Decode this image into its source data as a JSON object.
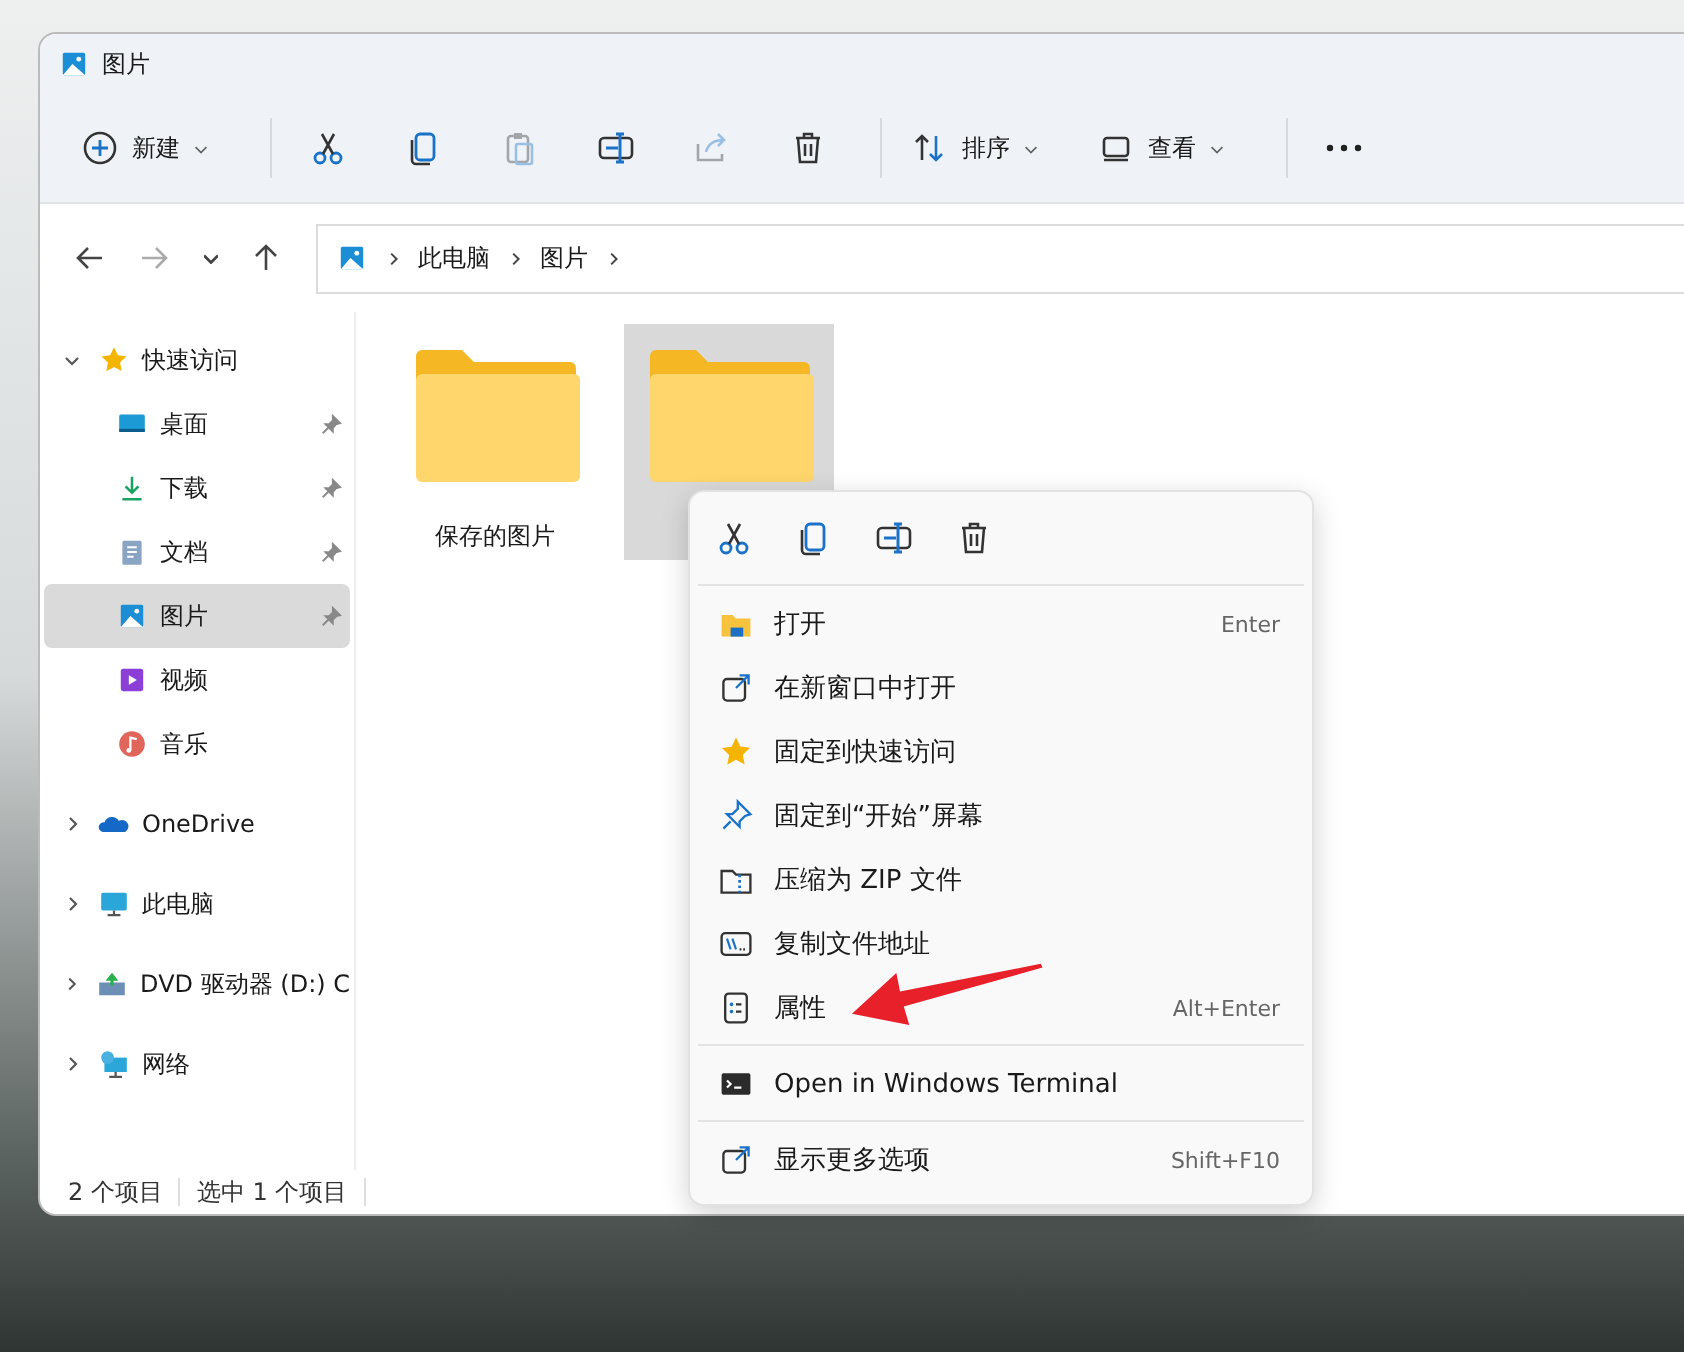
{
  "window": {
    "title": "图片"
  },
  "toolbar": {
    "items": [
      {
        "kind": "new",
        "label": "新建",
        "disabled": false
      },
      {
        "kind": "cut",
        "disabled": false
      },
      {
        "kind": "copy",
        "disabled": false
      },
      {
        "kind": "paste",
        "disabled": true
      },
      {
        "kind": "rename",
        "disabled": false
      },
      {
        "kind": "share",
        "disabled": true
      },
      {
        "kind": "delete",
        "disabled": false
      },
      {
        "kind": "sort",
        "label": "排序",
        "disabled": false
      },
      {
        "kind": "view",
        "label": "查看",
        "disabled": false
      },
      {
        "kind": "more",
        "disabled": false
      }
    ]
  },
  "navigation": {
    "back_disabled": false,
    "forward_disabled": true
  },
  "breadcrumb": [
    "此电脑",
    "图片"
  ],
  "sidebar": {
    "items": [
      {
        "kind": "star",
        "label": "快速访问",
        "expanded": true,
        "selected": false,
        "children": [
          {
            "kind": "desktop",
            "label": "桌面",
            "pinned": true,
            "selected": false
          },
          {
            "kind": "download",
            "label": "下载",
            "pinned": true,
            "selected": false
          },
          {
            "kind": "documents",
            "label": "文档",
            "pinned": true,
            "selected": false
          },
          {
            "kind": "pictures",
            "label": "图片",
            "pinned": true,
            "selected": true
          },
          {
            "kind": "videos",
            "label": "视频",
            "pinned": false,
            "selected": false
          },
          {
            "kind": "music",
            "label": "音乐",
            "pinned": false,
            "selected": false
          }
        ]
      },
      {
        "kind": "onedrive",
        "label": "OneDrive",
        "expanded": false,
        "selected": false
      },
      {
        "kind": "pc",
        "label": "此电脑",
        "expanded": false,
        "selected": false
      },
      {
        "kind": "dvd",
        "label": "DVD 驱动器 (D:) C",
        "expanded": false,
        "selected": false
      },
      {
        "kind": "network",
        "label": "网络",
        "expanded": false,
        "selected": false
      }
    ]
  },
  "files": [
    {
      "name": "保存的图片",
      "selected": false
    },
    {
      "selected": true
    }
  ],
  "status_bar": {
    "item_count": "2 个项目",
    "selection": "选中 1 个项目"
  },
  "context_menu": {
    "quick_actions": [
      {
        "kind": "cut"
      },
      {
        "kind": "copy"
      },
      {
        "kind": "rename"
      },
      {
        "kind": "delete"
      }
    ],
    "sections": [
      [
        {
          "kind": "open",
          "label": "打开",
          "shortcut": "Enter"
        },
        {
          "kind": "newwindow",
          "label": "在新窗口中打开"
        },
        {
          "kind": "star",
          "label": "固定到快速访问"
        },
        {
          "kind": "pin",
          "label": "固定到“开始”屏幕"
        },
        {
          "kind": "zip",
          "label": "压缩为 ZIP 文件"
        },
        {
          "kind": "path",
          "label": "复制文件地址"
        },
        {
          "kind": "properties",
          "label": "属性",
          "shortcut": "Alt+Enter"
        }
      ],
      [
        {
          "kind": "terminal",
          "label": "Open in Windows Terminal"
        }
      ],
      [
        {
          "kind": "more",
          "label": "显示更多选项",
          "shortcut": "Shift+F10"
        }
      ]
    ]
  }
}
